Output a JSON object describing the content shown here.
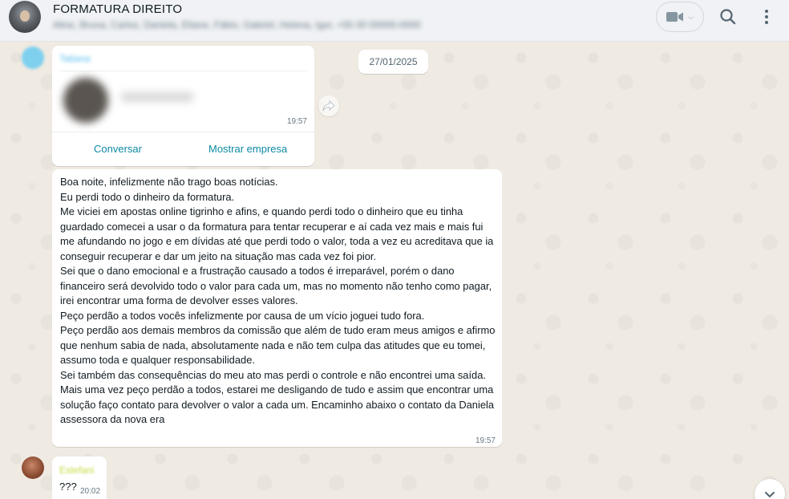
{
  "header": {
    "group_name": "FORMATURA DIREITO",
    "members_preview": "Aline, Bruna, Carlos, Daniela, Eliane, Fábio, Gabriel, Helena, Igor, +55 00 00000-0000"
  },
  "date_chip": "27/01/2025",
  "contact_card": {
    "sender": "Tatiana",
    "time": "19:57",
    "actions": [
      "Conversar",
      "Mostrar empresa"
    ]
  },
  "message": {
    "text": "Boa noite, infelizmente não trago boas notícias.\nEu perdi todo o dinheiro da formatura.\nMe viciei em apostas online tigrinho e afins, e quando perdi todo o dinheiro que eu tinha guardado comecei a usar o da formatura para tentar recuperar e aí cada vez mais e mais fui me afundando no jogo e em dívidas até que perdi todo o valor, toda a vez eu acreditava que ia conseguir recuperar e dar um jeito na situação mas cada vez foi pior.\nSei que o dano emocional e a frustração  causado a todos é irreparável, porém o dano financeiro será devolvido todo o valor para cada um, mas no momento não tenho como pagar, irei encontrar uma forma de devolver esses valores.\nPeço perdão a todos vocês infelizmente por causa de um vício joguei tudo fora.\nPeço perdão aos demais membros da comissão que além de tudo eram meus amigos e afirmo que nenhum sabia de nada, absolutamente nada e não tem culpa das atitudes que eu tomei, assumo toda e qualquer responsabilidade.\nSei também das consequências do meu ato mas perdi o controle e não encontrei uma saída.\nMais uma vez peço perdão a todos, estarei me desligando de tudo e assim que encontrar uma solução faço contato para devolver o valor a cada um. Encaminho abaixo o contato da Daniela assessora da nova era",
    "time": "19:57"
  },
  "reply": {
    "sender": "Estefani",
    "text": "???",
    "time": "20:02"
  },
  "icons": [
    "video-call-icon",
    "chevron-down-icon",
    "search-icon",
    "menu-dots-icon",
    "forward-icon",
    "scroll-down-icon"
  ],
  "colors": {
    "chat_background": "#efeae2",
    "bubble": "#ffffff",
    "link": "#0e8aa6",
    "meta_text": "#667781"
  }
}
